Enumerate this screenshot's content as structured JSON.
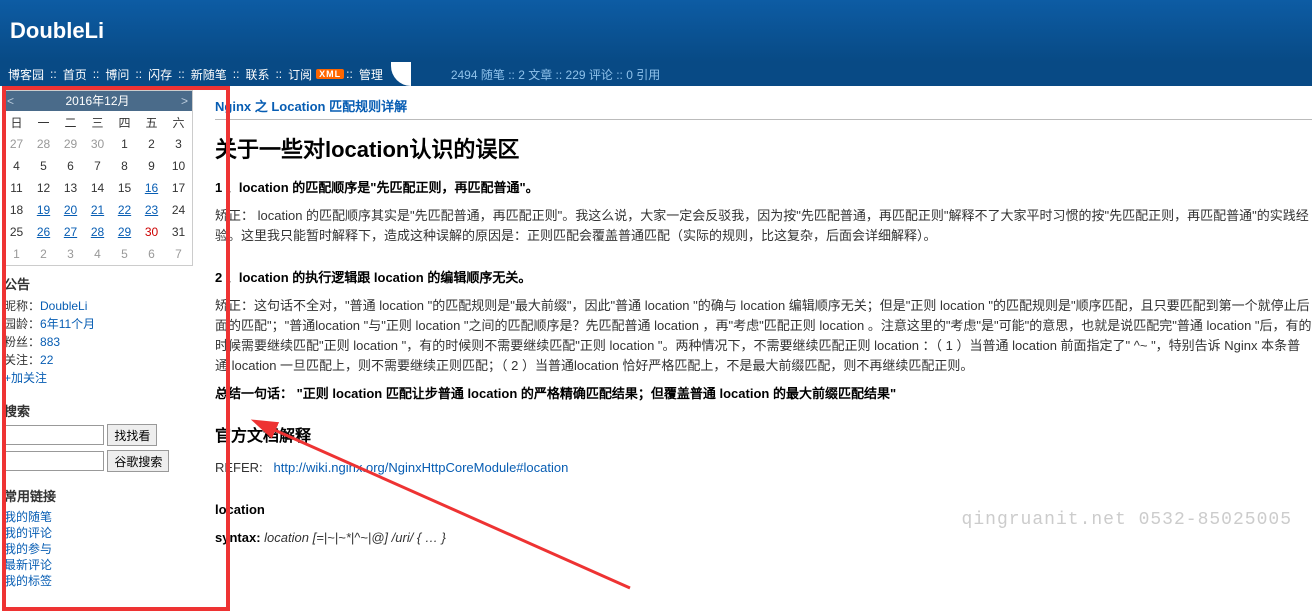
{
  "header": {
    "title": "DoubleLi"
  },
  "nav": {
    "items": [
      "博客园",
      "首页",
      "博问",
      "闪存",
      "新随笔",
      "联系",
      "订阅"
    ],
    "rss": "XML",
    "manage": "管理",
    "stats": "2494 随笔 :: 2 文章 :: 229 评论 :: 0 引用"
  },
  "calendar": {
    "month": "2016年12月",
    "dow": [
      "日",
      "一",
      "二",
      "三",
      "四",
      "五",
      "六"
    ],
    "weeks": [
      [
        {
          "d": "27",
          "c": "gray"
        },
        {
          "d": "28",
          "c": "gray"
        },
        {
          "d": "29",
          "c": "gray"
        },
        {
          "d": "30",
          "c": "gray"
        },
        {
          "d": "1"
        },
        {
          "d": "2"
        },
        {
          "d": "3"
        }
      ],
      [
        {
          "d": "4"
        },
        {
          "d": "5"
        },
        {
          "d": "6"
        },
        {
          "d": "7"
        },
        {
          "d": "8"
        },
        {
          "d": "9"
        },
        {
          "d": "10"
        }
      ],
      [
        {
          "d": "11"
        },
        {
          "d": "12"
        },
        {
          "d": "13"
        },
        {
          "d": "14"
        },
        {
          "d": "15"
        },
        {
          "d": "16",
          "c": "link"
        },
        {
          "d": "17"
        }
      ],
      [
        {
          "d": "18"
        },
        {
          "d": "19",
          "c": "link"
        },
        {
          "d": "20",
          "c": "link"
        },
        {
          "d": "21",
          "c": "link"
        },
        {
          "d": "22",
          "c": "link"
        },
        {
          "d": "23",
          "c": "link"
        },
        {
          "d": "24"
        }
      ],
      [
        {
          "d": "25"
        },
        {
          "d": "26",
          "c": "link"
        },
        {
          "d": "27",
          "c": "link"
        },
        {
          "d": "28",
          "c": "link"
        },
        {
          "d": "29",
          "c": "link"
        },
        {
          "d": "30",
          "c": "red"
        },
        {
          "d": "31"
        }
      ],
      [
        {
          "d": "1",
          "c": "gray"
        },
        {
          "d": "2",
          "c": "gray"
        },
        {
          "d": "3",
          "c": "gray"
        },
        {
          "d": "4",
          "c": "gray"
        },
        {
          "d": "5",
          "c": "gray"
        },
        {
          "d": "6",
          "c": "gray"
        },
        {
          "d": "7",
          "c": "gray"
        }
      ]
    ]
  },
  "announce": {
    "title": "公告",
    "rows": [
      {
        "label": "昵称：",
        "value": "DoubleLi",
        "link": true
      },
      {
        "label": "园龄：",
        "value": "6年11个月",
        "link": true
      },
      {
        "label": "粉丝：",
        "value": "883",
        "link": true
      },
      {
        "label": "关注：",
        "value": "22",
        "link": true
      }
    ],
    "follow": "+加关注"
  },
  "search": {
    "title": "搜索",
    "btn1": "找找看",
    "btn2": "谷歌搜索"
  },
  "links": {
    "title": "常用链接",
    "items": [
      "我的随笔",
      "我的评论",
      "我的参与",
      "最新评论",
      "我的标签"
    ]
  },
  "article": {
    "breadcrumb": "Nginx 之 Location 匹配规则详解",
    "h1": "关于一些对location认识的误区",
    "p1_label": "1 、location 的匹配顺序是\"先匹配正则，再匹配普通\"。",
    "p1_body": "矫正： location 的匹配顺序其实是\"先匹配普通，再匹配正则\"。我这么说，大家一定会反驳我，因为按\"先匹配普通，再匹配正则\"解释不了大家平时习惯的按\"先匹配正则，再匹配普通\"的实践经验。这里我只能暂时解释下，造成这种误解的原因是：正则匹配会覆盖普通匹配（实际的规则，比这复杂，后面会详细解释）。",
    "p2_label": "2 、location 的执行逻辑跟 location 的编辑顺序无关。",
    "p2_body": "矫正：这句话不全对，\"普通 location \"的匹配规则是\"最大前缀\"，因此\"普通 location \"的确与 location 编辑顺序无关；但是\"正则 location \"的匹配规则是\"顺序匹配，且只要匹配到第一个就停止后面的匹配\"；\"普通location \"与\"正则 location \"之间的匹配顺序是？先匹配普通 location ，再\"考虑\"匹配正则 location 。注意这里的\"考虑\"是\"可能\"的意思，也就是说匹配完\"普通 location \"后，有的时候需要继续匹配\"正则 location \"，有的时候则不需要继续匹配\"正则 location \"。两种情况下，不需要继续匹配正则 location ：（ 1 ）当普通 location 前面指定了\" ^~ \"，特别告诉 Nginx 本条普通 location 一旦匹配上，则不需要继续正则匹配；（ 2 ）当普通location 恰好严格匹配上，不是最大前缀匹配，则不再继续匹配正则。",
    "summary": "总结一句话：  \"正则 location 匹配让步普通 location 的严格精确匹配结果；但覆盖普通 location 的最大前缀匹配结果\"",
    "h2": "官方文档解释",
    "refer_label": "REFER:",
    "refer_link": "http://wiki.nginx.org/NginxHttpCoreModule#location",
    "loc": "location",
    "syntax_label": "syntax:",
    "syntax_val": "location [=|~|~*|^~|@] /uri/ { … }"
  },
  "watermark": "qingruanit.net 0532-85025005"
}
